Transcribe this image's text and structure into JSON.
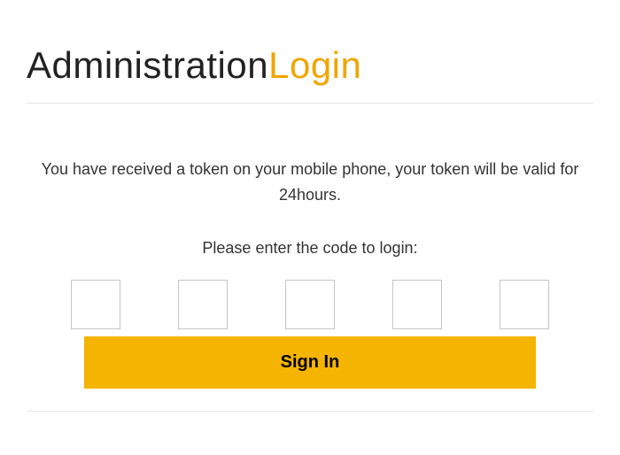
{
  "header": {
    "title_part1": "Administration",
    "title_part2": "Login"
  },
  "content": {
    "info_text": "You have received a token on your mobile phone, your token will be valid for 24hours.",
    "prompt_text": "Please enter the code to login:",
    "signin_label": "Sign In"
  },
  "code_inputs": {
    "values": [
      "",
      "",
      "",
      "",
      ""
    ]
  },
  "colors": {
    "accent": "#f5b400",
    "highlight": "#f0a500"
  }
}
